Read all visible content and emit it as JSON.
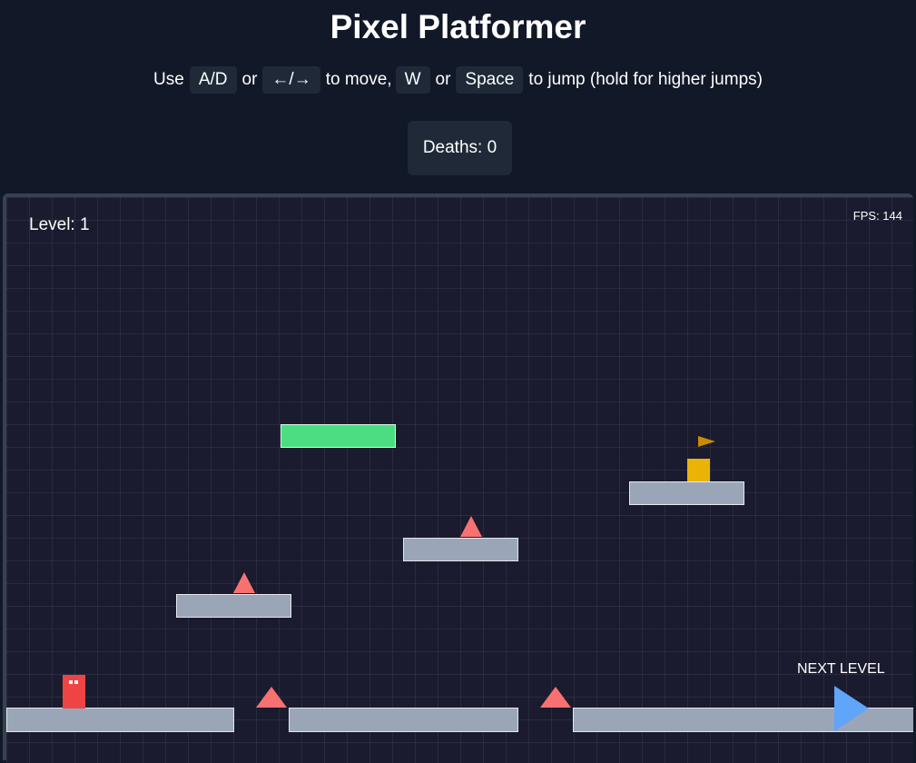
{
  "header": {
    "title": "Pixel Platformer",
    "instructions": {
      "use": "Use",
      "key_ad": "A/D",
      "or1": "or",
      "key_arrows": "←/→",
      "to_move": "to move,",
      "key_w": "W",
      "or2": "or",
      "key_space": "Space",
      "to_jump": "to jump (hold for higher jumps)"
    }
  },
  "stats": {
    "deaths": "Deaths: 0"
  },
  "game": {
    "level": "Level: 1",
    "fps": "FPS: 144",
    "next_level": "NEXT LEVEL",
    "colors": {
      "background": "#1a1b2e",
      "platform": "#9aa6b8",
      "moving_platform": "#4ade80",
      "spike": "#f87171",
      "player": "#ef4444",
      "goal_block": "#eab308",
      "exit_arrow": "#60a5fa"
    }
  }
}
